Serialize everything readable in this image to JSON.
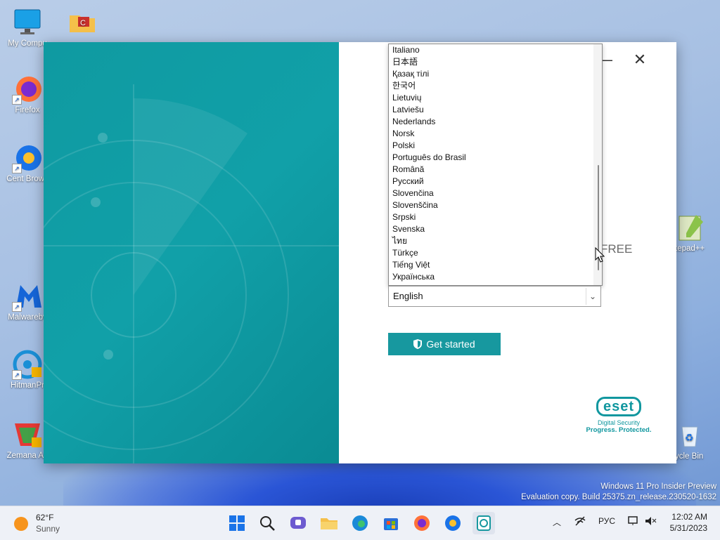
{
  "desktop": {
    "icons": [
      {
        "label": "My Compu",
        "icon": "computer-icon"
      },
      {
        "label": "",
        "icon": "folder-icon"
      },
      {
        "label": "Firefox",
        "icon": "firefox-icon"
      },
      {
        "label": "Cent Brows",
        "icon": "cent-browser-icon"
      },
      {
        "label": "Malwareby",
        "icon": "malwarebytes-icon"
      },
      {
        "label": "HitmanPr",
        "icon": "hitmanpro-icon"
      },
      {
        "label": "Zemana An",
        "icon": "zemana-icon"
      },
      {
        "label": "tepad++",
        "icon": "notepadpp-icon"
      },
      {
        "label": "ycle Bin",
        "icon": "recycle-bin-icon"
      }
    ],
    "watermark_line1": "Windows 11 Pro Insider Preview",
    "watermark_line2": "Evaluation copy. Build 25375.zn_release.230520-1632"
  },
  "installer": {
    "minimize_label": "—",
    "close_label": "✕",
    "languages": [
      "Italiano",
      "日本語",
      "Қазақ тілі",
      "한국어",
      "Lietuvių",
      "Latviešu",
      "Nederlands",
      "Norsk",
      "Polski",
      "Português do Brasil",
      "Română",
      "Русский",
      "Slovenčina",
      "Slovenščina",
      "Srpski",
      "Svenska",
      "ไทย",
      "Türkçe",
      "Tiếng Việt",
      "Українська"
    ],
    "free_text": "FREE",
    "selected_language": "English",
    "get_started_label": "Get started",
    "logo_text": "eset",
    "logo_sub1": "Digital Security",
    "logo_sub2": "Progress. Protected.",
    "accent_color": "#17989f"
  },
  "taskbar": {
    "weather_temp": "62°F",
    "weather_cond": "Sunny",
    "apps": [
      "start-icon",
      "search-icon",
      "meet-icon",
      "file-explorer-icon",
      "edge-icon",
      "store-icon",
      "firefox-icon",
      "cent-browser-icon",
      "eset-installer-icon"
    ],
    "language": "РУС",
    "time": "12:02 AM",
    "date": "5/31/2023"
  }
}
